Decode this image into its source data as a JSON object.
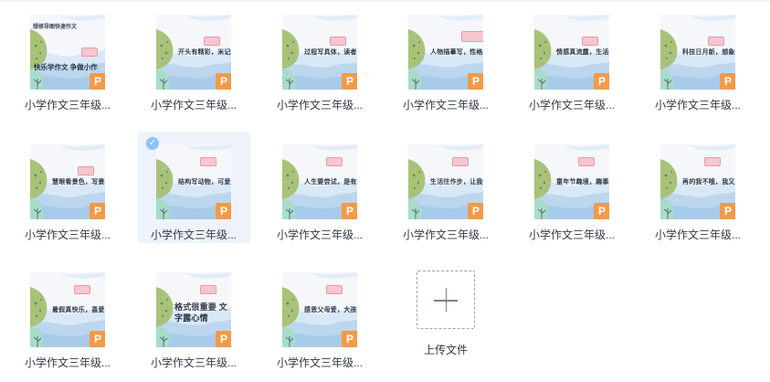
{
  "files": [
    {
      "name": "小学作文三年级...",
      "slide_text": "快乐学作文 争做小作",
      "slide_subtitle": "想修导图快速作文",
      "variant": "cover",
      "selected": false
    },
    {
      "name": "小学作文三年级...",
      "slide_text": "开头有精彩，米记梯",
      "variant": "tag",
      "selected": false
    },
    {
      "name": "小学作文三年级...",
      "slide_text": "过程写具体，读者刚",
      "variant": "tag",
      "selected": false
    },
    {
      "name": "小学作文三年级...",
      "slide_text": "人物描摹写，性格鲜",
      "variant": "banner",
      "selected": false
    },
    {
      "name": "小学作文三年级...",
      "slide_text": "情感真流露，生活化",
      "variant": "tag",
      "selected": false
    },
    {
      "name": "小学作文三年级...",
      "slide_text": "科技日月新，想象新",
      "variant": "tag",
      "selected": false
    },
    {
      "name": "小学作文三年级...",
      "slide_text": "慧眼看景色，写景要",
      "variant": "tag",
      "selected": false
    },
    {
      "name": "小学作文三年级...",
      "slide_text": "结构写动物，可爱又",
      "variant": "plain",
      "selected": true
    },
    {
      "name": "小学作文三年级...",
      "slide_text": "人生要尝试，是有所",
      "variant": "plain",
      "selected": false
    },
    {
      "name": "小学作文三年级...",
      "slide_text": "生活往作步，让我一",
      "variant": "plain",
      "selected": false
    },
    {
      "name": "小学作文三年级...",
      "slide_text": "童年节趣境，趣事一",
      "variant": "plain",
      "selected": false
    },
    {
      "name": "小学作文三年级...",
      "slide_text": "再的我不哦，我又",
      "variant": "plain",
      "selected": false
    },
    {
      "name": "小学作文三年级...",
      "slide_text": "暑假真快乐，喜爱写",
      "variant": "plain",
      "selected": false
    },
    {
      "name": "小学作文三年级...",
      "slide_text": "格式很重要 文字露心情",
      "variant": "big",
      "selected": false
    },
    {
      "name": "小学作文三年级...",
      "slide_text": "感恩父母爱，大孩",
      "variant": "plain",
      "selected": false
    }
  ],
  "file_badge": "P",
  "selected_check": "✓",
  "upload": {
    "label": "上传文件"
  },
  "colors": {
    "thumb_bg": "#f5f7fb",
    "wave_blue": "#bcd6ee",
    "wave_light": "#d9e8f6",
    "blob_green": "#a9c27a",
    "mint": "#a8dcc9",
    "ppt_orange": "#f39a48",
    "selected_bg": "#eef3fb",
    "check_blue": "#8ec3f5"
  }
}
